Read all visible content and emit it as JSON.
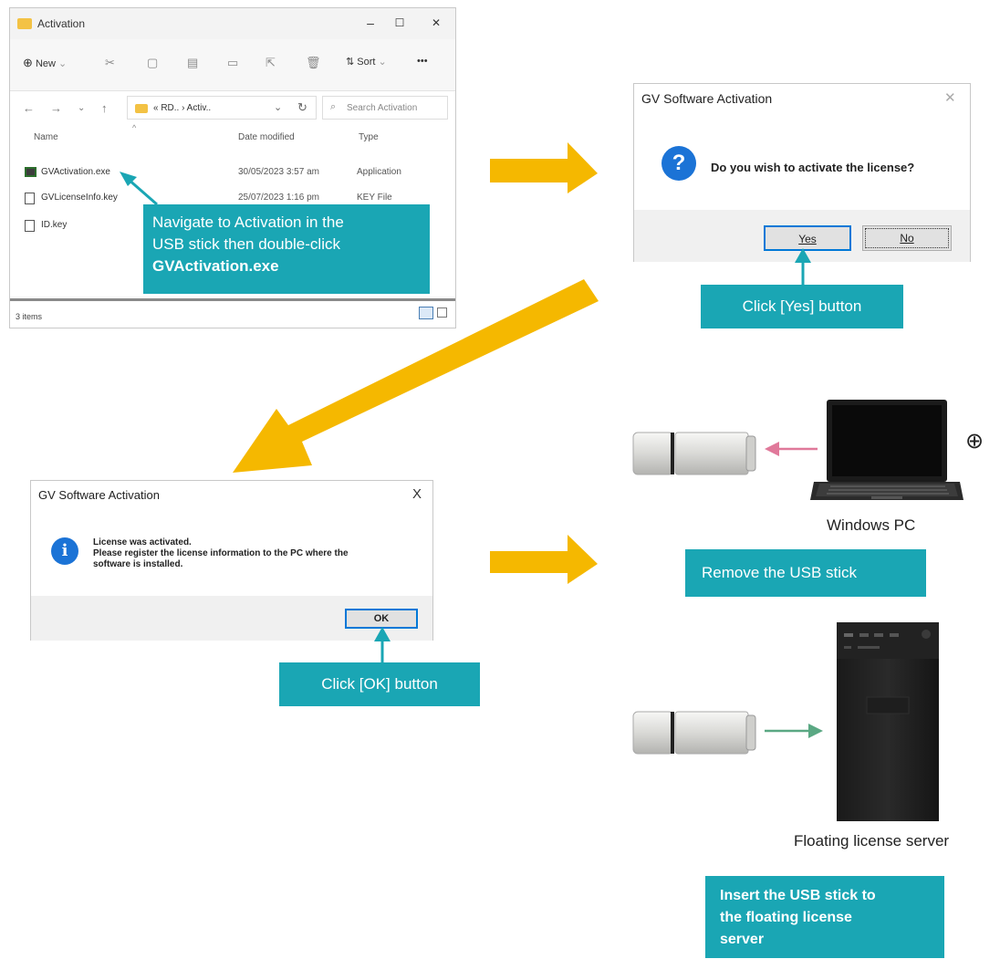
{
  "explorer": {
    "title": "Activation",
    "controls": {
      "minimize": "–",
      "maximize": "☐",
      "close": "✕"
    },
    "toolbar": {
      "new_label": "New",
      "sort_label": "Sort",
      "more_label": "•••"
    },
    "address": {
      "path": "« RD.. › Activ..",
      "search_placeholder": "Search Activation"
    },
    "columns": {
      "name": "Name",
      "date": "Date modified",
      "type": "Type"
    },
    "files": [
      {
        "name": "GVActivation.exe",
        "date": "30/05/2023 3:57 am",
        "type": "Application",
        "kind": "exe"
      },
      {
        "name": "GVLicenseInfo.key",
        "date": "25/07/2023 1:16 pm",
        "type": "KEY File",
        "kind": "file"
      },
      {
        "name": "ID.key",
        "date": "",
        "type": "",
        "kind": "file"
      }
    ],
    "status": "3 items"
  },
  "callout_explorer": {
    "line1": "Navigate to Activation in the",
    "line2": "USB stick then double-click",
    "line3": "GVActivation.exe"
  },
  "dialog_confirm": {
    "title": "GV Software Activation",
    "close": "✕",
    "icon": "?",
    "message": "Do you wish to activate the license?",
    "yes_label": "Yes",
    "no_label": "No"
  },
  "callout_yes": "Click [Yes] button",
  "dialog_done": {
    "title": "GV Software Activation",
    "close": "X",
    "icon": "i",
    "line1": "License was activated.",
    "line2": "Please register the license information to the PC where the",
    "line3": "software is installed.",
    "ok_label": "OK"
  },
  "callout_ok": "Click [OK] button",
  "windows_pc_label": "Windows PC",
  "globe_icon": "⊕",
  "callout_remove": "Remove the USB stick",
  "server_label": "Floating license server",
  "callout_insert": {
    "line1": "Insert the USB stick to",
    "line2": "the floating license",
    "line3": "server"
  },
  "colors": {
    "accent": "#1aa6b4",
    "arrow": "#f5b800",
    "pink_arrow": "#e0799a",
    "green_arrow": "#5aa883"
  }
}
